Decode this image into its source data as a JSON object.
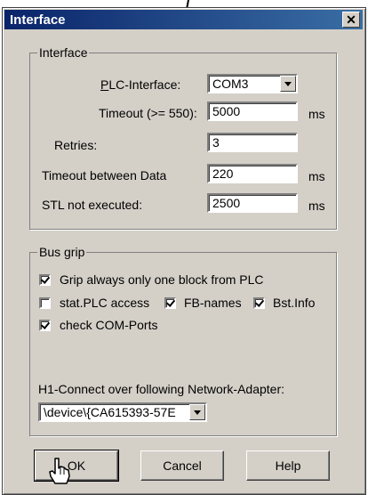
{
  "window": {
    "title": "Interface",
    "close_label": "✕"
  },
  "interface_group": {
    "legend": "Interface",
    "plc_interface_label": "PLC-Interface:",
    "plc_interface_value": "COM3",
    "timeout_label": "Timeout (>= 550):",
    "timeout_value": "5000",
    "timeout_unit": "ms",
    "retries_label": "Retries:",
    "retries_value": "3",
    "timeout_data_label": "Timeout between Data",
    "timeout_data_value": "220",
    "timeout_data_unit": "ms",
    "stl_label": "STL not executed:",
    "stl_value": "2500",
    "stl_unit": "ms"
  },
  "bus_group": {
    "legend": "Bus grip",
    "grip_label": "Grip always only one block from PLC",
    "grip_checked": true,
    "stat_label": "stat.PLC access",
    "stat_checked": false,
    "fb_label": "FB-names",
    "fb_checked": true,
    "bst_label": "Bst.Info",
    "bst_checked": true,
    "com_label": "check COM-Ports",
    "com_checked": true,
    "h1_label": "H1-Connect over following Network-Adapter:",
    "h1_value": "\\device\\{CA615393-57E"
  },
  "buttons": {
    "ok": "OK",
    "cancel": "Cancel",
    "help": "Help"
  }
}
